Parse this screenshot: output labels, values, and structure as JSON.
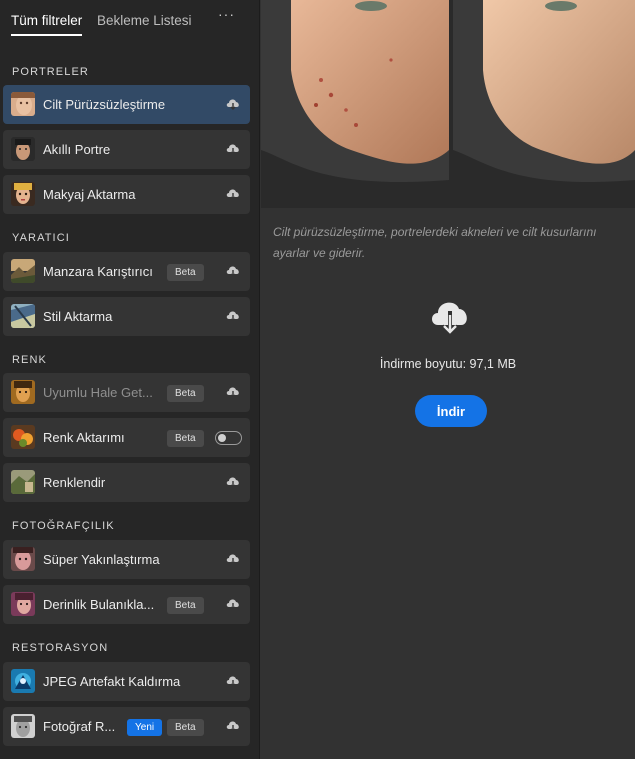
{
  "tabs": {
    "active": "Tüm filtreler",
    "inactive": "Bekleme Listesi",
    "more": "···"
  },
  "sections": [
    {
      "title": "PORTRELER"
    },
    {
      "title": "YARATICI"
    },
    {
      "title": "RENK"
    },
    {
      "title": "FOTOĞRAFÇILIK"
    },
    {
      "title": "RESTORASYON"
    }
  ],
  "filters": [
    {
      "label": "Cilt Pürüzsüzleştirme",
      "icon": "skin-smoothing-thumb",
      "state": "selected"
    },
    {
      "label": "Akıllı Portre",
      "icon": "smart-portrait-thumb"
    },
    {
      "label": "Makyaj Aktarma",
      "icon": "makeup-transfer-thumb"
    },
    {
      "label": "Manzara Karıştırıcı",
      "icon": "landscape-mixer-thumb",
      "badge": "Beta"
    },
    {
      "label": "Stil Aktarma",
      "icon": "style-transfer-thumb"
    },
    {
      "label": "Uyumlu Hale Get...",
      "icon": "harmonization-thumb",
      "badge": "Beta",
      "dim": true
    },
    {
      "label": "Renk Aktarımı",
      "icon": "color-transfer-thumb",
      "badge": "Beta",
      "toggle": "off"
    },
    {
      "label": "Renklendir",
      "icon": "colorize-thumb"
    },
    {
      "label": "Süper Yakınlaştırma",
      "icon": "super-zoom-thumb"
    },
    {
      "label": "Derinlik Bulanıkla...",
      "icon": "depth-blur-thumb",
      "badge": "Beta"
    },
    {
      "label": "JPEG Artefakt Kaldırma",
      "icon": "jpeg-artifact-thumb"
    },
    {
      "label": "Fotoğraf R...",
      "icon": "photo-restoration-thumb",
      "badge_new": "Yeni",
      "badge": "Beta"
    }
  ],
  "main": {
    "description": "Cilt pürüzsüzleştirme, portrelerdeki akneleri ve cilt kusurlarını ayarlar ve giderir.",
    "download_size": "İndirme boyutu: 97,1 MB",
    "download_button": "İndir"
  },
  "colors": {
    "accent": "#1473e6",
    "selected_row": "#324a66",
    "sidebar_bg": "#262626",
    "main_bg": "#323232"
  }
}
